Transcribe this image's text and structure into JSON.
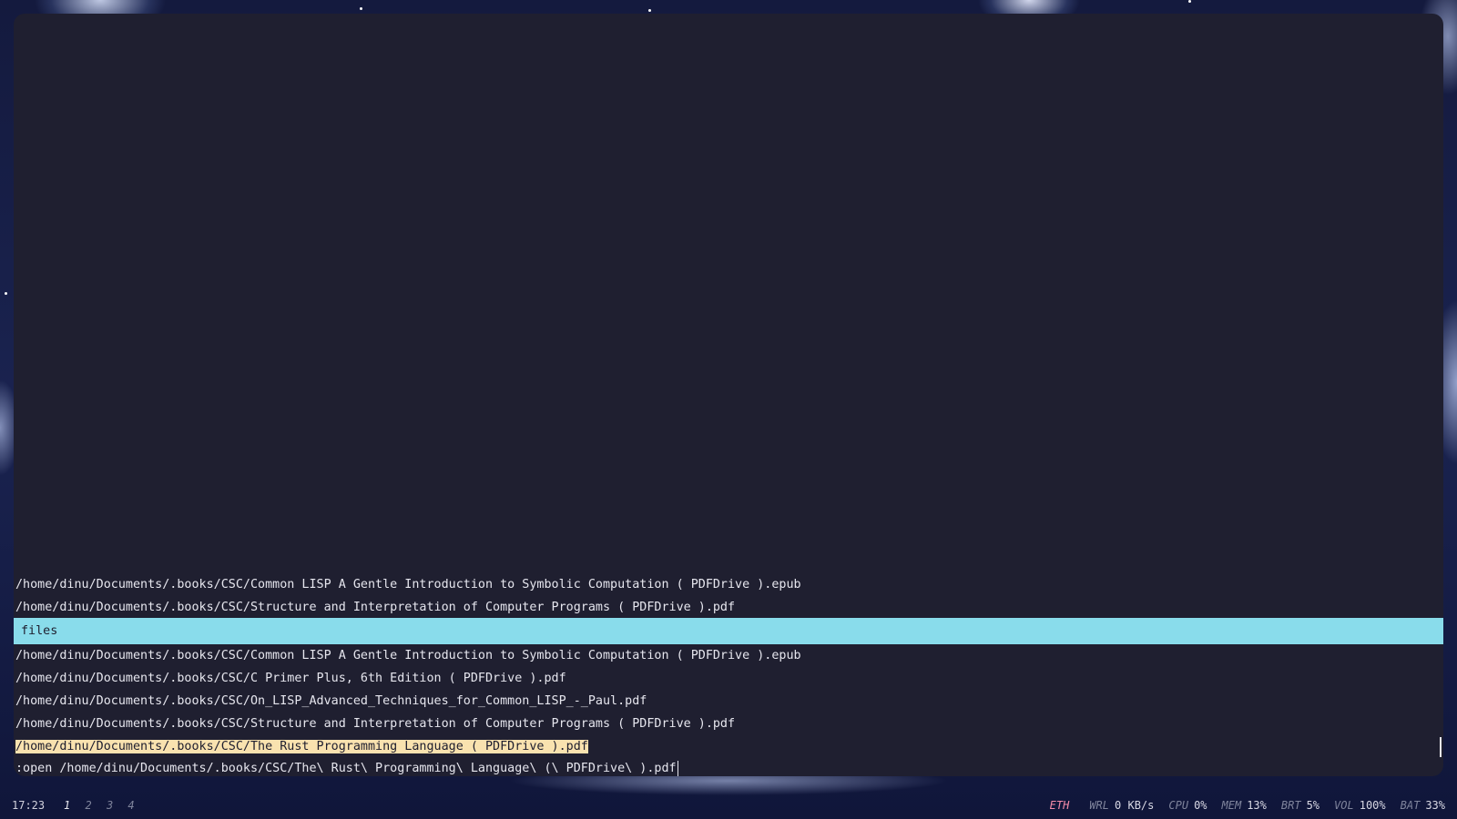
{
  "terminal": {
    "top_lines": [
      "/home/dinu/Documents/.books/CSC/Common LISP A Gentle Introduction to Symbolic Computation ( PDFDrive ).epub",
      "/home/dinu/Documents/.books/CSC/Structure and Interpretation of Computer Programs ( PDFDrive ).pdf"
    ],
    "section_title": "files",
    "file_items": [
      "/home/dinu/Documents/.books/CSC/Common LISP A Gentle Introduction to Symbolic Computation ( PDFDrive ).epub",
      "/home/dinu/Documents/.books/CSC/C Primer Plus, 6th Edition ( PDFDrive ).pdf",
      "/home/dinu/Documents/.books/CSC/On_LISP_Advanced_Techniques_for_Common_LISP_-_Paul.pdf",
      "/home/dinu/Documents/.books/CSC/Structure and Interpretation of Computer Programs ( PDFDrive ).pdf",
      "/home/dinu/Documents/.books/CSC/The Rust Programming Language ( PDFDrive ).pdf"
    ],
    "selected_index": 4,
    "command": ":open /home/dinu/Documents/.books/CSC/The\\ Rust\\ Programming\\ Language\\ (\\ PDFDrive\\ ).pdf"
  },
  "statusbar": {
    "clock": "17:23",
    "workspaces": [
      "1",
      "2",
      "3",
      "4"
    ],
    "active_workspace": "1",
    "eth_label": "ETH",
    "wrl_label": "WRL",
    "wrl_value": "0 KB/s",
    "cpu_label": "CPU",
    "cpu_value": "0%",
    "mem_label": "MEM",
    "mem_value": "13%",
    "brt_label": "BRT",
    "brt_value": "5%",
    "vol_label": "VOL",
    "vol_value": "100%",
    "bat_label": "BAT",
    "bat_value": "33%"
  },
  "colors": {
    "section_bar": "#89dceb",
    "selection": "#f9e2af",
    "eth_alert": "#f38ba8"
  }
}
